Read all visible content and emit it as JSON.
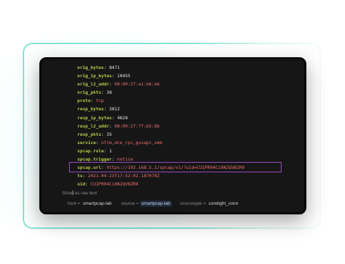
{
  "event": {
    "fields": [
      {
        "key": "orig_bytes",
        "value": "8471",
        "kind": "num"
      },
      {
        "key": "orig_ip_bytes",
        "value": "10455",
        "kind": "num"
      },
      {
        "key": "orig_l2_addr",
        "value": "08:00:27:a1:b6:e6",
        "kind": "str"
      },
      {
        "key": "orig_pkts",
        "value": "38",
        "kind": "num"
      },
      {
        "key": "proto",
        "value": "tcp",
        "kind": "str"
      },
      {
        "key": "resp_bytes",
        "value": "2812",
        "kind": "num"
      },
      {
        "key": "resp_ip_bytes",
        "value": "4628",
        "kind": "num"
      },
      {
        "key": "resp_l2_addr",
        "value": "08:00:27:7f:b5:8b",
        "kind": "str"
      },
      {
        "key": "resp_pkts",
        "value": "35",
        "kind": "num"
      },
      {
        "key": "service",
        "value": "ntlm,dce_rpc,gssapi,smb",
        "kind": "str"
      },
      {
        "key": "spcap.rule",
        "value": "1",
        "kind": "num"
      },
      {
        "key": "spcap.trigger",
        "value": "notice",
        "kind": "str"
      },
      {
        "key": "spcap.url",
        "value": "https://192.168.5.1/spcap/v1/?uid=CU1PR04Ci8N2QVBZR9",
        "kind": "str"
      },
      {
        "key": "ts",
        "value": "2021-04-23T17:52:02.187078Z",
        "kind": "str"
      },
      {
        "key": "uid",
        "value": "CU1PR04Ci8N2QVBZR9",
        "kind": "str"
      }
    ],
    "closing_brace": "}",
    "show_raw_text": "Show as raw text"
  },
  "meta": {
    "host_label": "host =",
    "host_value": "smartpcap-lab",
    "source_label": "source =",
    "source_value": "smartpcap-lab",
    "sourcetype_label": "sourcetype =",
    "sourcetype_value": "corelight_conn"
  },
  "colors": {
    "key": "#b8c84a",
    "string_value": "#ef6f6f",
    "highlight": "#9b4fc7",
    "frame_outline": "#7fe3cf"
  }
}
